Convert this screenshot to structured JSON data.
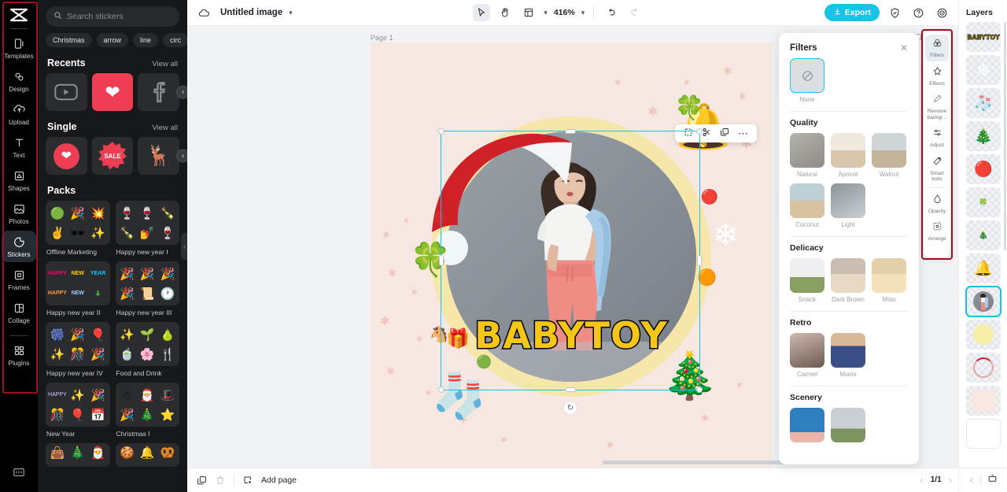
{
  "rail": {
    "logo": "capcut-logo",
    "items": [
      {
        "label": "Templates",
        "icon": "templates-icon",
        "active": false
      },
      {
        "label": "Design",
        "icon": "design-icon",
        "active": false
      },
      {
        "label": "Upload",
        "icon": "upload-icon",
        "active": false
      },
      {
        "label": "Text",
        "icon": "text-icon",
        "active": false
      },
      {
        "label": "Shapes",
        "icon": "shapes-icon",
        "active": false
      },
      {
        "label": "Photos",
        "icon": "photos-icon",
        "active": false
      },
      {
        "label": "Stickers",
        "icon": "stickers-icon",
        "active": true
      },
      {
        "label": "Frames",
        "icon": "frames-icon",
        "active": false
      },
      {
        "label": "Collage",
        "icon": "collage-icon",
        "active": false
      },
      {
        "label": "Plugins",
        "icon": "plugins-icon",
        "active": false
      }
    ],
    "bottom_icon": "keyboard-shortcuts-icon",
    "highlight_color": "#9c1120"
  },
  "stickers": {
    "search": {
      "placeholder": "Search stickers",
      "value": ""
    },
    "tags": [
      "Christmas",
      "arrow",
      "line",
      "circ"
    ],
    "recents": {
      "title": "Recents",
      "view_all": "View all",
      "items": [
        "youtube-sticker",
        "heart-sticker",
        "facebook-sticker"
      ]
    },
    "single": {
      "title": "Single",
      "view_all": "View all",
      "items": [
        "heart-sticker",
        "sale-badge-sticker",
        "reindeer-sticker"
      ]
    },
    "packs": {
      "title": "Packs",
      "items": [
        {
          "name": "Offline Marketing"
        },
        {
          "name": "Happy new year I"
        },
        {
          "name": "Happy new year II"
        },
        {
          "name": "Happy new year III"
        },
        {
          "name": "Happy new year IV"
        },
        {
          "name": "Food and Drink"
        },
        {
          "name": "New Year"
        },
        {
          "name": "Christmas I"
        },
        {
          "name": ""
        },
        {
          "name": ""
        }
      ]
    }
  },
  "topbar": {
    "cloud_icon": "cloud-saved-icon",
    "title": "Untitled image",
    "title_caret": "chevron-down-icon",
    "tools": [
      {
        "name": "select-tool",
        "icon": "cursor-icon",
        "selected": true
      },
      {
        "name": "hand-tool",
        "icon": "hand-icon",
        "selected": false
      },
      {
        "name": "layout-tool",
        "icon": "layout-icon",
        "selected": false
      }
    ],
    "layout_caret": "chevron-down-icon",
    "zoom": "416%",
    "zoom_caret": "chevron-down-icon",
    "undo": "undo-icon",
    "redo": "redo-icon",
    "export_label": "Export",
    "export_color": "#17c3e6",
    "shield_icon": "shield-icon",
    "help_icon": "help-icon",
    "settings_icon": "settings-icon"
  },
  "canvas": {
    "page_label": "Page 1",
    "page_tools": [
      "duplicate-page-icon",
      "more-options-icon"
    ],
    "headline": "BABYTOY",
    "headline_color": "#f5c518",
    "background_color": "#f7e7e1",
    "float_toolbar": [
      "crop-icon",
      "cutout-icon",
      "duplicate-icon",
      "more-icon"
    ],
    "selection_color": "#19c0e8",
    "rotate_icon": "rotate-icon"
  },
  "bottombar": {
    "duplicate_page": "duplicate-page-icon",
    "delete_page": "trash-icon",
    "add_page_icon": "add-page-icon",
    "add_page_label": "Add page",
    "page_prev": "chevron-left-icon",
    "page_count": "1/1",
    "page_next": "chevron-right-icon",
    "timeline_icon": "timeline-icon"
  },
  "filters": {
    "title": "Filters",
    "close_icon": "close-icon",
    "none": {
      "label": "None",
      "icon": "no-filter-icon",
      "selected": true
    },
    "groups": [
      {
        "title": "Quality",
        "items": [
          {
            "label": "Natural",
            "c1": "#b4b1ad",
            "c2": "#8f8c88"
          },
          {
            "label": "Apricot",
            "c1": "#efe8dd",
            "c2": "#d7c6ac"
          },
          {
            "label": "Walnut",
            "c1": "#cfd5d4",
            "c2": "#c4b49a"
          },
          {
            "label": "Coconut",
            "c1": "#bcd0d6",
            "c2": "#d8c2a0"
          },
          {
            "label": "Light",
            "c1": "#8e9397",
            "c2": "#c9cfd3"
          }
        ]
      },
      {
        "title": "Delicacy",
        "items": [
          {
            "label": "Snack",
            "c1": "#efeff1",
            "c2": "#88a05f"
          },
          {
            "label": "Dark Brown",
            "c1": "#cbbdb2",
            "c2": "#e8d9c4"
          },
          {
            "label": "Miso",
            "c1": "#e4cfab",
            "c2": "#f2e1bb"
          }
        ]
      },
      {
        "title": "Retro",
        "items": [
          {
            "label": "Carmel",
            "c1": "#cdb9ae",
            "c2": "#6d5a52"
          },
          {
            "label": "Miami",
            "c1": "#3a4e88",
            "c2": "#d9b89a"
          }
        ]
      },
      {
        "title": "Scenery",
        "items": [
          {
            "label": "",
            "c1": "#2e7ec0",
            "c2": "#e8b6a8"
          },
          {
            "label": "",
            "c1": "#c9cfd2",
            "c2": "#7d9460"
          }
        ]
      }
    ]
  },
  "toolrail": {
    "items": [
      {
        "label": "Filters",
        "icon": "filters-icon",
        "active": true
      },
      {
        "label": "Effects",
        "icon": "effects-icon",
        "active": false
      },
      {
        "label": "Remove backgr...",
        "icon": "remove-background-icon",
        "active": false
      },
      {
        "label": "Adjust",
        "icon": "adjust-icon",
        "active": false
      },
      {
        "label": "Smart tools",
        "icon": "smart-tools-icon",
        "active": false
      },
      {
        "label": "Opacity",
        "icon": "opacity-icon",
        "active": false
      },
      {
        "label": "Arrange",
        "icon": "arrange-icon",
        "active": false
      }
    ],
    "highlight_color": "#9c1120"
  },
  "layers": {
    "title": "Layers",
    "items": [
      {
        "name": "text-layer-babytoy",
        "selected": false
      },
      {
        "name": "snowflake-layer",
        "selected": false
      },
      {
        "name": "stocking-layer",
        "selected": false
      },
      {
        "name": "christmas-tree-layer",
        "selected": false
      },
      {
        "name": "red-ornament-layer",
        "selected": false
      },
      {
        "name": "holly-small-layer",
        "selected": false
      },
      {
        "name": "candy-cane-layer",
        "selected": false
      },
      {
        "name": "bells-layer",
        "selected": false
      },
      {
        "name": "photo-layer",
        "selected": true
      },
      {
        "name": "yellow-circle-layer",
        "selected": false
      },
      {
        "name": "santa-ring-layer",
        "selected": false
      },
      {
        "name": "background-pattern-layer",
        "selected": false
      },
      {
        "name": "white-background-layer",
        "selected": false
      }
    ],
    "footer": {
      "prev": "chevron-right-icon",
      "timeline": "timeline-icon"
    }
  }
}
